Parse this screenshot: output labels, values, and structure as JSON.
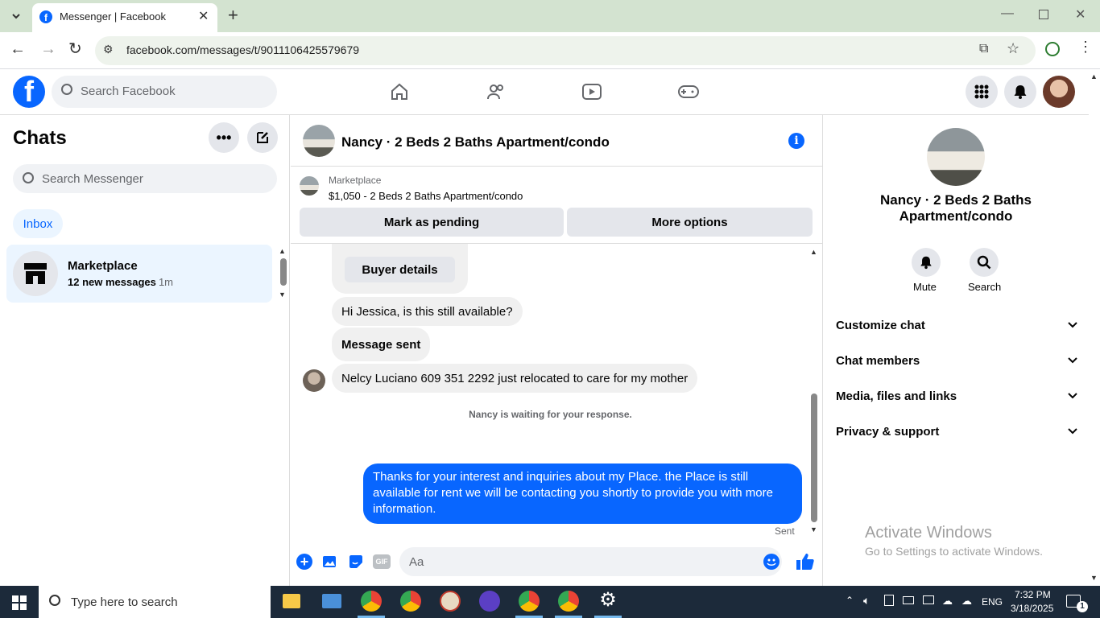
{
  "browser": {
    "tab_title": "Messenger | Facebook",
    "url": "facebook.com/messages/t/9011106425579679"
  },
  "fb": {
    "search_placeholder": "Search Facebook"
  },
  "sidebar": {
    "title": "Chats",
    "search_placeholder": "Search Messenger",
    "filter_inbox": "Inbox",
    "chats": [
      {
        "name": "Marketplace",
        "preview": "12 new messages",
        "time": "· 1m"
      }
    ]
  },
  "conversation": {
    "title": "Nancy · 2 Beds 2 Baths Apartment/condo",
    "listing_source": "Marketplace",
    "listing_title": "$1,050 - 2 Beds 2 Baths Apartment/condo",
    "mark_pending": "Mark as pending",
    "more_options": "More options",
    "buyer_details": "Buyer details",
    "messages": [
      {
        "text": "Hi Jessica, is this still available?"
      },
      {
        "text": "Message sent"
      },
      {
        "text": "Nelcy Luciano 609 351 2292 just relocated to care for my mother"
      }
    ],
    "waiting_note": "Nancy is waiting for your response.",
    "outgoing": "Thanks for your interest and inquiries about my Place. the Place is still available for rent we will be contacting you shortly to provide you with more information.",
    "sent_status": "Sent",
    "composer_placeholder": "Aa"
  },
  "details": {
    "name": "Nancy · 2 Beds 2 Baths Apartment/condo",
    "mute_label": "Mute",
    "search_label": "Search",
    "sections": [
      "Customize chat",
      "Chat members",
      "Media, files and links",
      "Privacy & support"
    ]
  },
  "watermark": {
    "title": "Activate Windows",
    "subtitle": "Go to Settings to activate Windows."
  },
  "taskbar": {
    "search_placeholder": "Type here to search",
    "lang": "ENG",
    "time": "7:32 PM",
    "date": "3/18/2025",
    "notif_count": "1"
  },
  "colors": {
    "fb_blue": "#0866ff",
    "bubble_grey": "#f0f0f0",
    "taskbar": "#1c2a3a"
  }
}
